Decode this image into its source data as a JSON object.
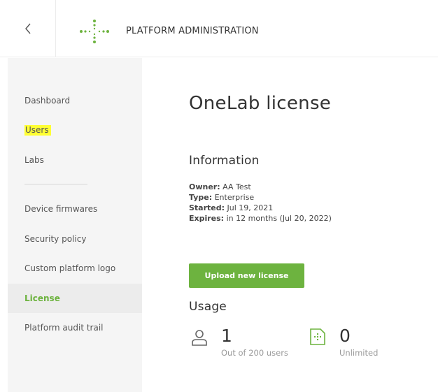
{
  "header": {
    "title": "PLATFORM ADMINISTRATION",
    "back_icon": "chevron-left-icon",
    "logo_icon": "dotted-cross-logo",
    "accent_color": "#6db33f"
  },
  "sidebar": {
    "items": [
      {
        "label": "Dashboard"
      },
      {
        "label": "Users",
        "highlighted": true
      },
      {
        "label": "Labs"
      },
      {
        "label": "Device firmwares"
      },
      {
        "label": "Security policy"
      },
      {
        "label": "Custom platform logo"
      },
      {
        "label": "License",
        "active": true
      },
      {
        "label": "Platform audit trail"
      }
    ]
  },
  "main": {
    "title": "OneLab license",
    "information": {
      "heading": "Information",
      "owner_label": "Owner:",
      "owner_value": "AA Test",
      "type_label": "Type:",
      "type_value": "Enterprise",
      "started_label": "Started:",
      "started_value": "Jul 19, 2021",
      "expires_label": "Expires:",
      "expires_value": "in 12 months (Jul 20, 2022)"
    },
    "upload_button": "Upload new license",
    "usage": {
      "heading": "Usage",
      "users": {
        "icon": "user-icon",
        "count": "1",
        "caption": "Out of 200 users"
      },
      "labs": {
        "icon": "lab-grid-icon",
        "count": "0",
        "caption": "Unlimited"
      }
    }
  }
}
